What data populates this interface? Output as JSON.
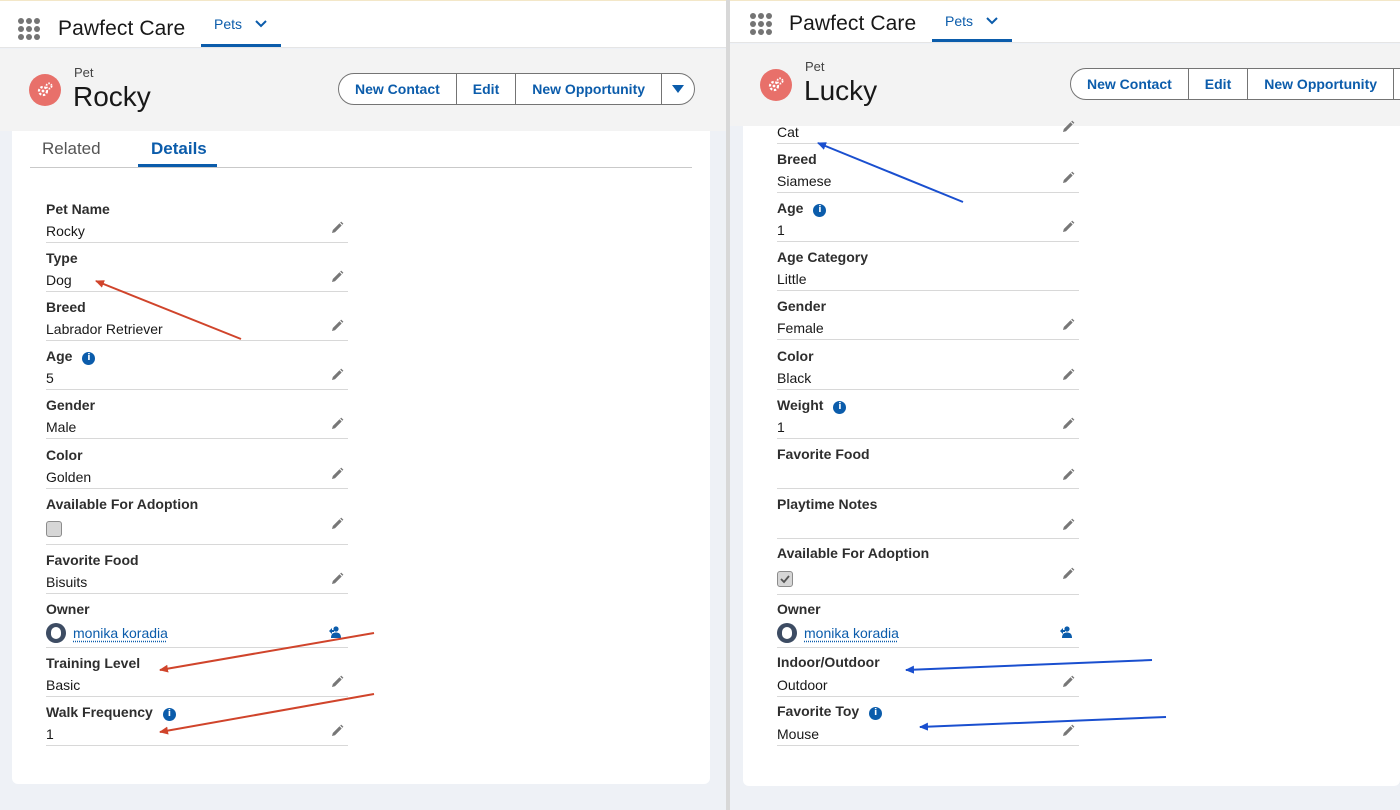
{
  "left": {
    "app_name": "Pawfect Care",
    "nav_tab": "Pets",
    "object_label": "Pet",
    "record_name": "Rocky",
    "buttons": [
      "New Contact",
      "Edit",
      "New Opportunity"
    ],
    "tabs": [
      "Related",
      "Details"
    ],
    "active_tab": "Details",
    "fields": [
      {
        "label": "Pet Name",
        "value": "Rocky"
      },
      {
        "label": "Type",
        "value": "Dog"
      },
      {
        "label": "Breed",
        "value": "Labrador Retriever"
      },
      {
        "label": "Age",
        "value": "5",
        "info": true
      },
      {
        "label": "Gender",
        "value": "Male"
      },
      {
        "label": "Color",
        "value": "Golden"
      },
      {
        "label": "Available For Adoption",
        "checked": false
      },
      {
        "label": "Favorite Food",
        "value": "Bisuits"
      },
      {
        "label": "Owner",
        "value": "monika koradia"
      },
      {
        "label": "Training Level",
        "value": "Basic"
      },
      {
        "label": "Walk Frequency",
        "value": "1",
        "info": true
      }
    ]
  },
  "right": {
    "app_name": "Pawfect Care",
    "nav_tab": "Pets",
    "object_label": "Pet",
    "record_name": "Lucky",
    "buttons": [
      "New Contact",
      "Edit",
      "New Opportunity"
    ],
    "fields": [
      {
        "label": "",
        "value": "Cat"
      },
      {
        "label": "Breed",
        "value": "Siamese"
      },
      {
        "label": "Age",
        "value": "1",
        "info": true
      },
      {
        "label": "Age Category",
        "value": "Little"
      },
      {
        "label": "Gender",
        "value": "Female"
      },
      {
        "label": "Color",
        "value": "Black"
      },
      {
        "label": "Weight",
        "value": "1",
        "info": true
      },
      {
        "label": "Favorite Food",
        "value": ""
      },
      {
        "label": "Playtime Notes",
        "value": ""
      },
      {
        "label": "Available For Adoption",
        "checked": true
      },
      {
        "label": "Owner",
        "value": "monika koradia"
      },
      {
        "label": "Indoor/Outdoor",
        "value": "Outdoor"
      },
      {
        "label": "Favorite Toy",
        "value": "Mouse",
        "info": true
      }
    ]
  },
  "colors": {
    "brand_blue": "#0b5cab",
    "pet_icon": "#e8706a",
    "arrow_red": "#d0442b",
    "arrow_blue": "#1a4fcf"
  }
}
